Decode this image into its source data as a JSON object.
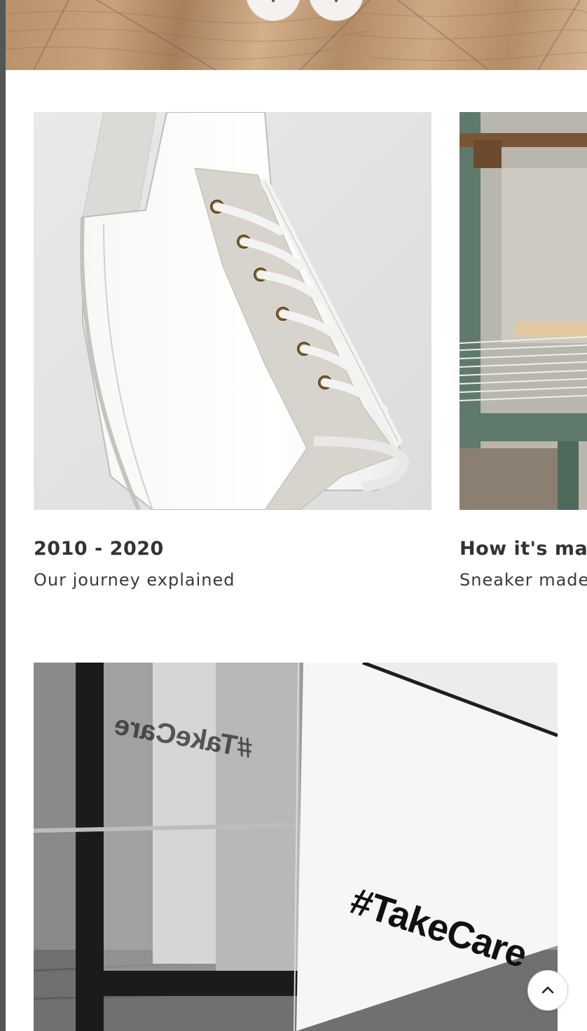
{
  "hero": {
    "prev_icon": "chevron-left-icon",
    "next_icon": "chevron-right-icon"
  },
  "cards": [
    {
      "title": "2010 - 2020",
      "subtitle": "Our journey explained",
      "image": "white-leather-sneaker"
    },
    {
      "title": "How it's mad",
      "subtitle": "Sneaker made",
      "image": "loom-weaving-machine"
    }
  ],
  "feature": {
    "sign_text": "#TakeCare",
    "mirror_text": "#TakeCare"
  },
  "scroll_top": {
    "icon": "chevron-up-icon"
  },
  "colors": {
    "text": "#333333",
    "background": "#ffffff"
  }
}
